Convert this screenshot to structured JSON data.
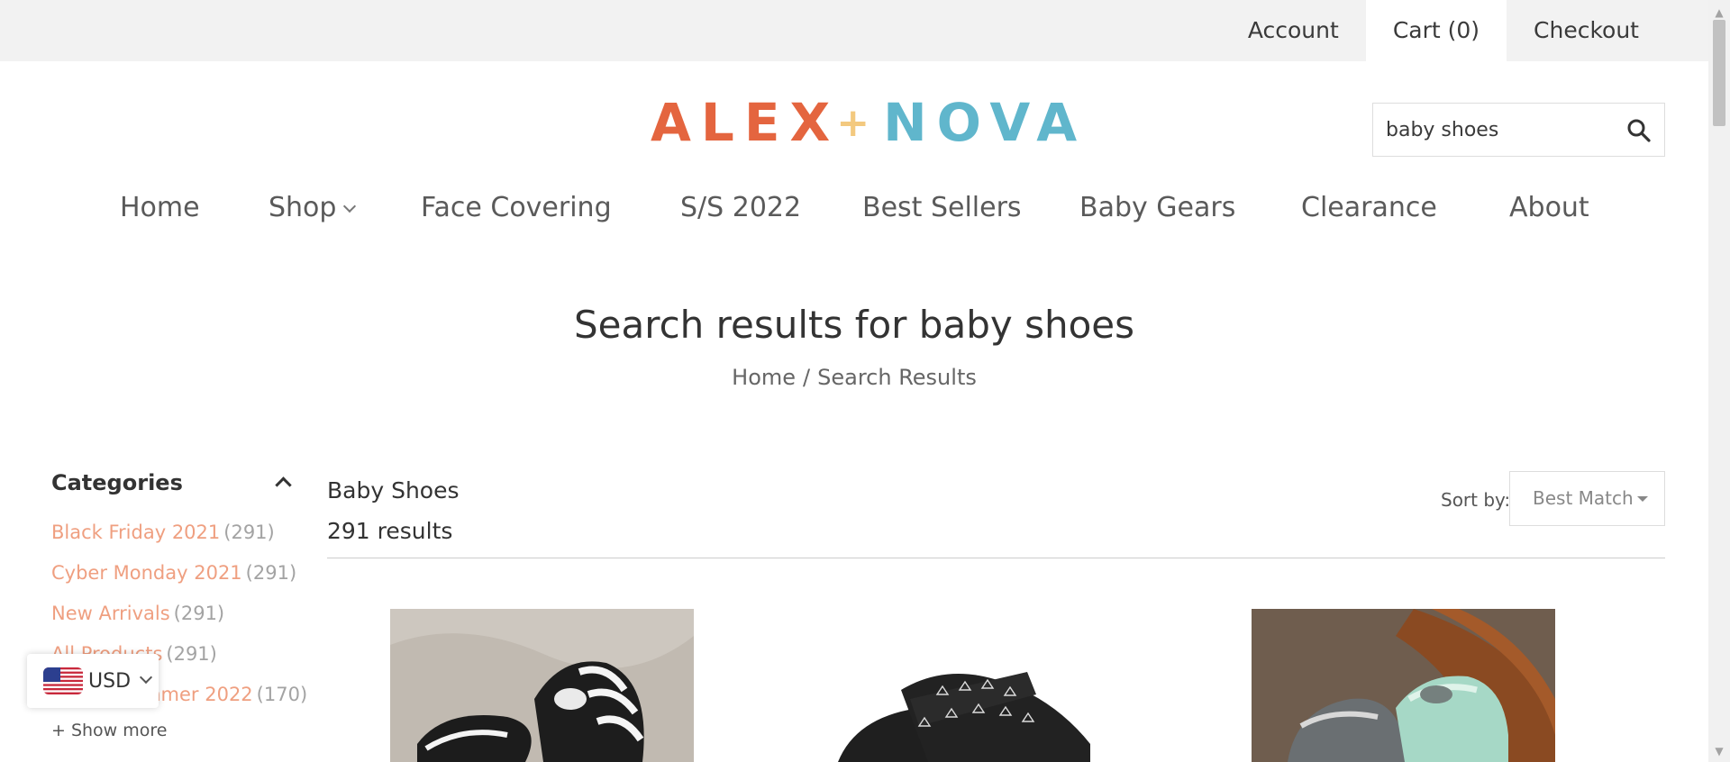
{
  "topbar": {
    "links": [
      "Account",
      "Cart (0)",
      "Checkout"
    ]
  },
  "logo": {
    "part1": "ALEX",
    "plus": "+",
    "part2": "NOVA",
    "colors": {
      "alex": "#e4653f",
      "plus": "#f3c97f",
      "nova": "#60b6cc"
    }
  },
  "search": {
    "value": "baby shoes",
    "icon": "search-icon"
  },
  "nav": {
    "items": [
      "Home",
      "Shop",
      "Face Covering",
      "S/S 2022",
      "Best Sellers",
      "Baby Gears",
      "Clearance",
      "About"
    ],
    "shop_icon": "chevron-down-icon"
  },
  "page": {
    "headline": "Search results for baby shoes",
    "breadcrumb": [
      "Home",
      "/",
      "Search Results"
    ]
  },
  "sidebar": {
    "title": "Categories",
    "toggle_icon": "chevron-up-icon",
    "categories": [
      {
        "name": "Black Friday 2021",
        "count": "(291)"
      },
      {
        "name": "Cyber Monday 2021",
        "count": "(291)"
      },
      {
        "name": "New Arrivals",
        "count": "(291)"
      },
      {
        "name": "All Products",
        "count": "(291)"
      },
      {
        "name": "Spring Summer 2022",
        "count": "(170)"
      }
    ],
    "show_more": "+ Show more"
  },
  "currency": {
    "code": "USD",
    "flag_icon": "us-flag-icon"
  },
  "results": {
    "collection": "Baby Shoes",
    "count": "291 results",
    "sort_label": "Sort by:",
    "sort_value": "Best Match"
  },
  "colors": {
    "category_link": "#ef9f80",
    "topbar_bg": "#f2f2f2"
  }
}
